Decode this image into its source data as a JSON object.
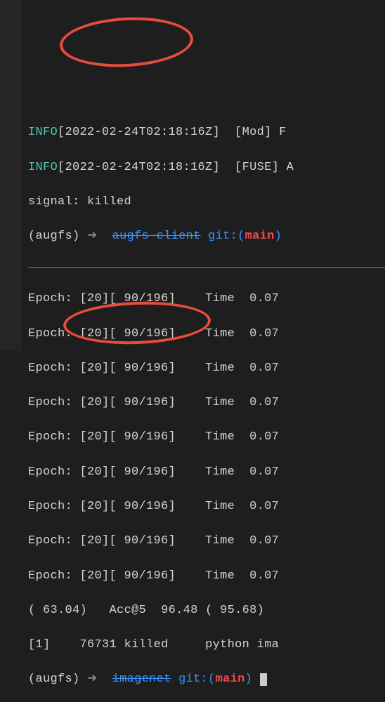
{
  "log1": {
    "level": "INFO",
    "ts": "[2022-02-24T02:18:16Z]",
    "mod": "[Mod]",
    "tail": "F"
  },
  "log2": {
    "level": "INFO",
    "ts": "[2022-02-24T02:18:16Z]",
    "mod": "[FUSE]",
    "tail": "A"
  },
  "signal_line": "signal: killed",
  "prompt1": {
    "env": "(augfs) ",
    "arrow": "➜  ",
    "dir": "augfs-client",
    "git_label": "git:(",
    "branch": "main",
    "git_close": ")"
  },
  "epoch": {
    "label": "Epoch: ",
    "idx": "[20][ 90/196]",
    "sp": "    ",
    "time_label": "Time",
    "time_val": "  0.07"
  },
  "acc_line": {
    "a1": "( 63.04)",
    "sp1": "   ",
    "a5_label": "Acc@5",
    "sp2": "  ",
    "a5_val": "96.48",
    "sp3": " ",
    "a5_p": "( 95.68)"
  },
  "kill_line": {
    "job": "[1]",
    "sp1": "    ",
    "pid": "76731",
    "sp2": " ",
    "msg": "killed",
    "sp3": "     ",
    "cmd": "python ima"
  },
  "prompt2": {
    "env": "(augfs) ",
    "arrow": "➜  ",
    "dir": "imagenet",
    "git_label": "git:(",
    "branch": "main",
    "git_close": ") "
  }
}
